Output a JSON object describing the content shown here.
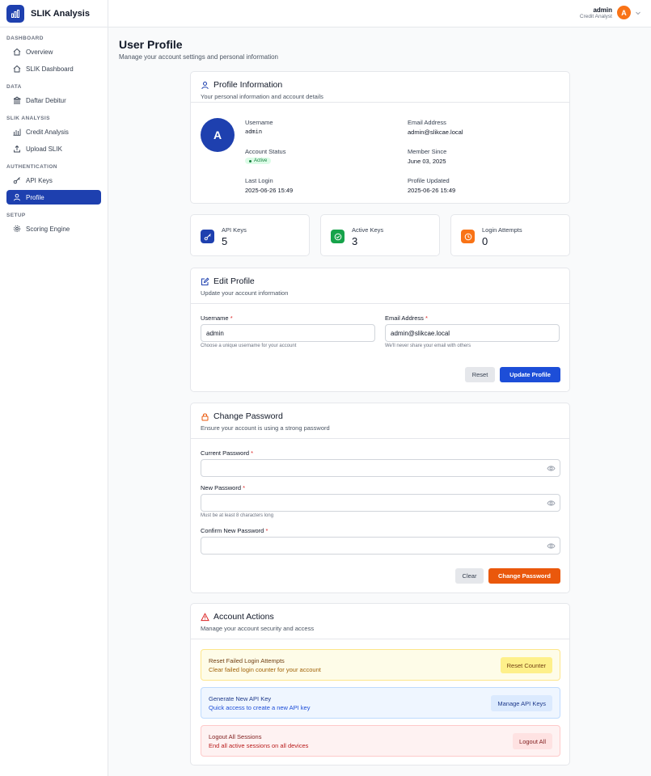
{
  "app": {
    "name": "SLIK Analysis"
  },
  "sidebar": {
    "sections": [
      {
        "header": "DASHBOARD",
        "items": [
          {
            "label": "Overview",
            "icon": "home-icon"
          },
          {
            "label": "SLIK Dashboard",
            "icon": "home-icon"
          }
        ]
      },
      {
        "header": "DATA",
        "items": [
          {
            "label": "Daftar Debitur",
            "icon": "bank-icon"
          }
        ]
      },
      {
        "header": "SLIK ANALYSIS",
        "items": [
          {
            "label": "Credit Analysis",
            "icon": "bar-chart-icon"
          },
          {
            "label": "Upload SLIK",
            "icon": "upload-icon"
          }
        ]
      },
      {
        "header": "AUTHENTICATION",
        "items": [
          {
            "label": "API Keys",
            "icon": "key-icon"
          },
          {
            "label": "Profile",
            "icon": "user-icon",
            "active": true
          }
        ]
      },
      {
        "header": "SETUP",
        "items": [
          {
            "label": "Scoring Engine",
            "icon": "gear-icon"
          }
        ]
      }
    ]
  },
  "topbar": {
    "user_name": "admin",
    "user_role": "Credit Analyst",
    "avatar_initial": "A"
  },
  "page": {
    "title": "User Profile",
    "subtitle": "Manage your account settings and personal information"
  },
  "profile_info": {
    "title": "Profile Information",
    "subtitle": "Your personal information and account details",
    "avatar_initial": "A",
    "username_label": "Username",
    "username": "admin",
    "email_label": "Email Address",
    "email": "admin@slikcae.local",
    "status_label": "Account Status",
    "status": "Active",
    "member_since_label": "Member Since",
    "member_since": "June 03, 2025",
    "last_login_label": "Last Login",
    "last_login": "2025-06-26 15:49",
    "updated_label": "Profile Updated",
    "updated": "2025-06-26 15:49"
  },
  "stats": [
    {
      "label": "API Keys",
      "value": "5",
      "icon": "key-icon",
      "color": "#1e40af"
    },
    {
      "label": "Active Keys",
      "value": "3",
      "icon": "check-circle-icon",
      "color": "#16a34a"
    },
    {
      "label": "Login Attempts",
      "value": "0",
      "icon": "clock-icon",
      "color": "#f97316"
    }
  ],
  "edit_profile": {
    "title": "Edit Profile",
    "subtitle": "Update your account information",
    "username_label": "Username",
    "username_value": "admin",
    "username_help": "Choose a unique username for your account",
    "email_label": "Email Address",
    "email_value": "admin@slikcae.local",
    "email_help": "We'll never share your email with others",
    "reset_label": "Reset",
    "submit_label": "Update Profile"
  },
  "change_password": {
    "title": "Change Password",
    "subtitle": "Ensure your account is using a strong password",
    "current_label": "Current Password",
    "new_label": "New Password",
    "new_help": "Must be at least 8 characters long",
    "confirm_label": "Confirm New Password",
    "clear_label": "Clear",
    "submit_label": "Change Password"
  },
  "account_actions": {
    "title": "Account Actions",
    "subtitle": "Manage your account security and access",
    "items": [
      {
        "title": "Reset Failed Login Attempts",
        "desc": "Clear failed login counter for your account",
        "button": "Reset Counter"
      },
      {
        "title": "Generate New API Key",
        "desc": "Quick access to create a new API key",
        "button": "Manage API Keys"
      },
      {
        "title": "Logout All Sessions",
        "desc": "End all active sessions on all devices",
        "button": "Logout All"
      }
    ]
  },
  "colors": {
    "primary": "#1e40af",
    "orange": "#ea580c",
    "success": "#16a34a",
    "danger": "#dc2626"
  }
}
